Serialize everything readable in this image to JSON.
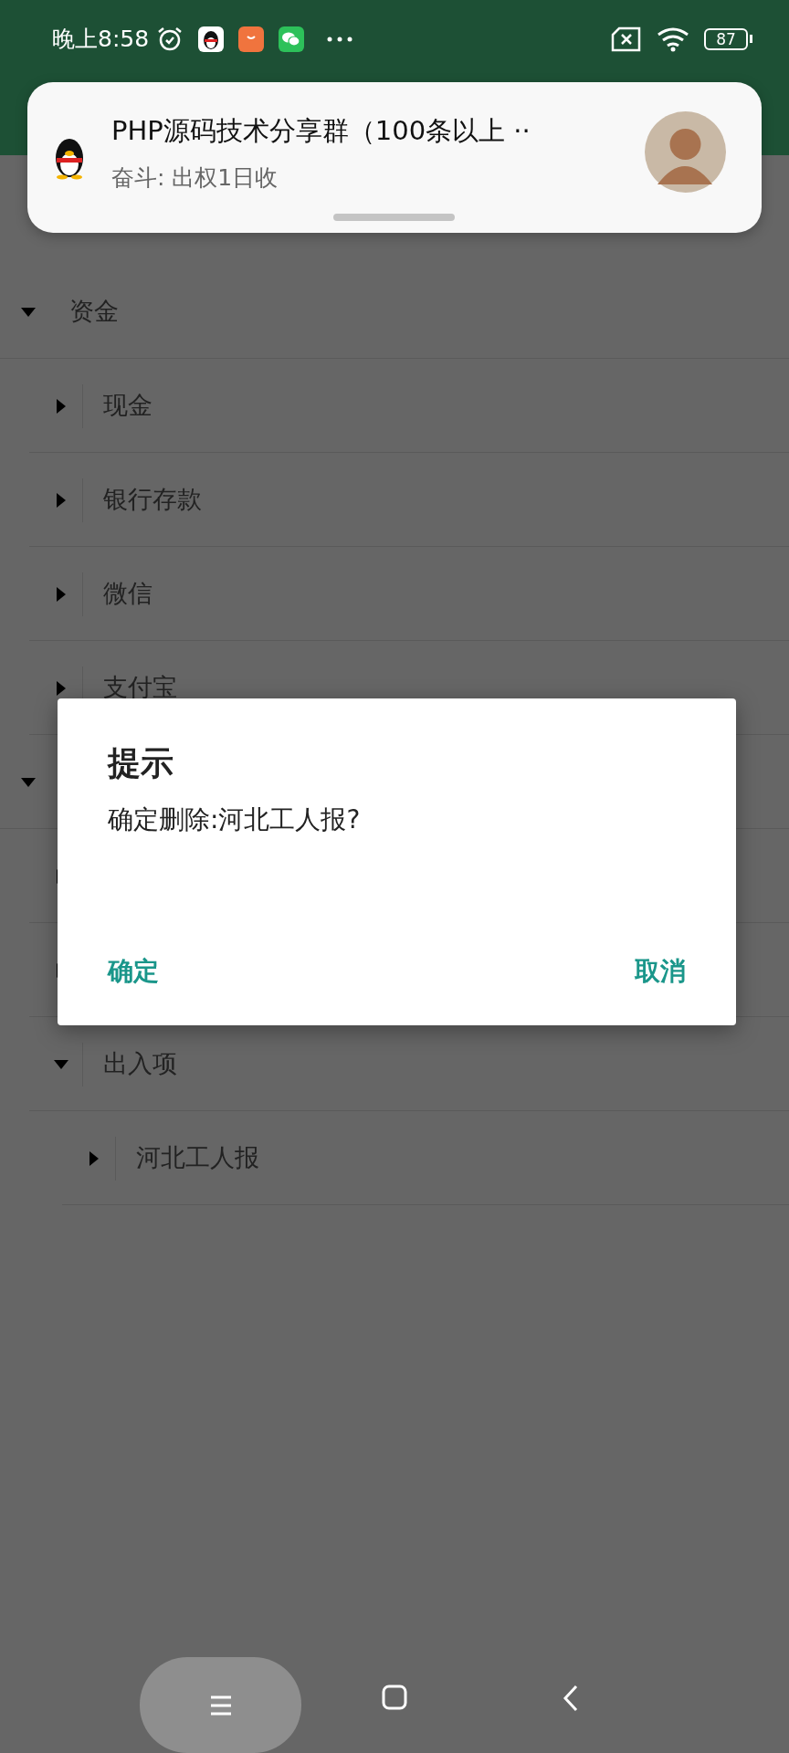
{
  "status_bar": {
    "time": "晚上8:58",
    "battery": "87"
  },
  "notification": {
    "title": "PHP源码技术分享群（100条以上 ··",
    "text": "奋斗: 出权1日收"
  },
  "tree": [
    {
      "label": "资金",
      "expanded": true,
      "children": [
        {
          "label": "现金",
          "expanded": false
        },
        {
          "label": "银行存款",
          "expanded": false
        },
        {
          "label": "微信",
          "expanded": false
        },
        {
          "label": "支付宝",
          "expanded": false
        }
      ]
    },
    {
      "expanded": true,
      "children": [
        {
          "expanded": false
        },
        {
          "expanded": false
        },
        {
          "label": "出入项",
          "expanded": true,
          "children": [
            {
              "label": "河北工人报",
              "expanded": false
            }
          ]
        }
      ]
    }
  ],
  "dialog": {
    "title": "提示",
    "message": "确定删除:河北工人报?",
    "buttons": [
      {
        "label": "确定"
      },
      {
        "label": "取消"
      }
    ]
  }
}
